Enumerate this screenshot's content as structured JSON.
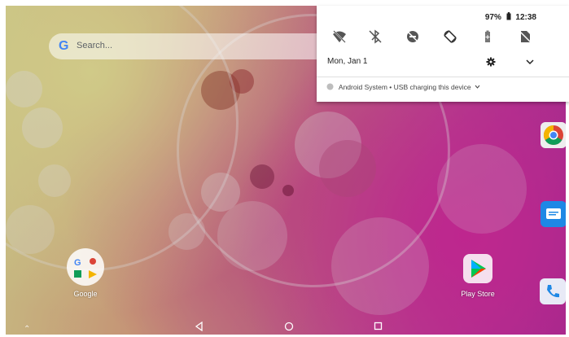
{
  "status_bar": {
    "battery": "97%",
    "time": "12:38"
  },
  "notification_shade": {
    "quick_settings": [
      {
        "name": "wifi-off-icon"
      },
      {
        "name": "bluetooth-off-icon"
      },
      {
        "name": "dnd-off-icon"
      },
      {
        "name": "auto-rotate-icon"
      },
      {
        "name": "battery-saver-icon"
      },
      {
        "name": "no-sim-icon"
      }
    ],
    "date": "Mon, Jan 1",
    "notification": {
      "app": "Android System",
      "separator": "•",
      "text": "USB charging this device"
    }
  },
  "home": {
    "search_placeholder": "Search...",
    "apps": [
      {
        "label": "Google"
      },
      {
        "label": "Play Store"
      }
    ]
  },
  "colors": {
    "accent": "#4285f4",
    "shade_bg": "#ffffff"
  }
}
